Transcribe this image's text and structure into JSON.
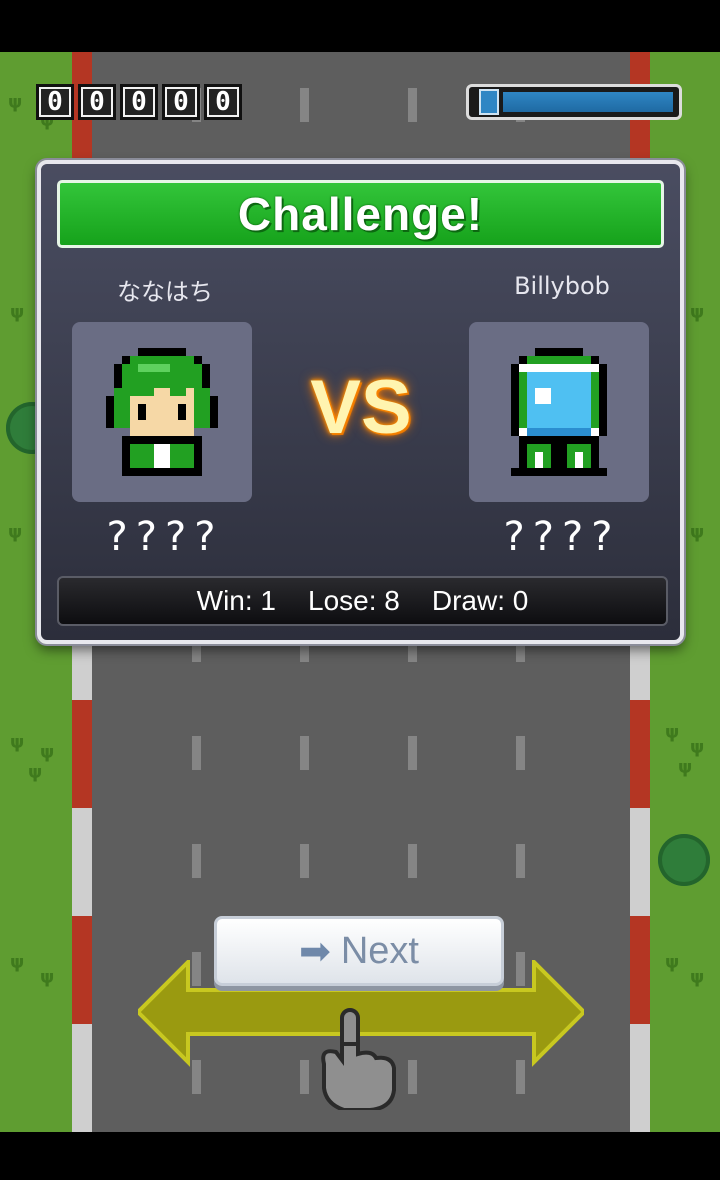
{
  "hud": {
    "score_digits": [
      "0",
      "0",
      "0",
      "0",
      "0"
    ],
    "gauge_icon": "fuel-gauge-icon",
    "gauge_level": 1.0
  },
  "challenge": {
    "title": "Challenge!",
    "vs_label": "VS",
    "player": {
      "name": "ななはち",
      "rank": "????"
    },
    "opponent": {
      "name": "Billybob",
      "rank": "????"
    },
    "record": {
      "win": "Win: 1",
      "lose": "Lose: 8",
      "draw": "Draw: 0"
    }
  },
  "next_button": {
    "label": "Next",
    "icon": "arrow-right-icon"
  },
  "hint": {
    "icon": "swipe-hand-icon"
  },
  "colors": {
    "title_green": "#16a21b",
    "vs_glow": "#ff8a00",
    "panel_bg": "#2c2e3b",
    "road": "#5e5e5e",
    "grass": "#5f9d31",
    "curb_red": "#b43623"
  }
}
